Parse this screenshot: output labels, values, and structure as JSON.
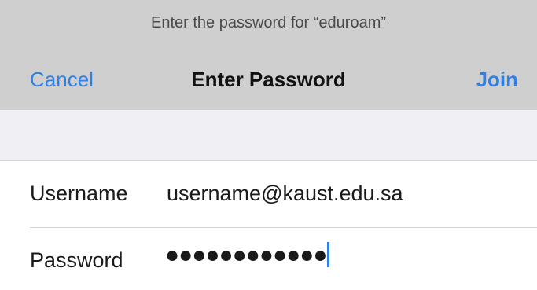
{
  "header": {
    "prompt": "Enter the password for “eduroam”",
    "cancel_label": "Cancel",
    "title": "Enter Password",
    "join_label": "Join"
  },
  "form": {
    "username": {
      "label": "Username",
      "value": "username@kaust.edu.sa"
    },
    "password": {
      "label": "Password",
      "masked_value": "●●●●●●●●●●●●"
    }
  },
  "colors": {
    "accent": "#2f80e6",
    "header_bg": "#cfcfcf",
    "section_bg": "#efeff4"
  }
}
